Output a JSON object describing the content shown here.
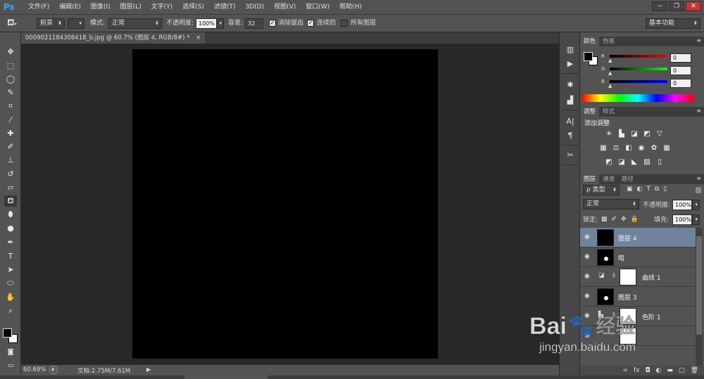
{
  "menubar": {
    "logo": "Ps",
    "items": [
      "文件(F)",
      "编辑(E)",
      "图像(I)",
      "图层(L)",
      "文字(Y)",
      "选择(S)",
      "滤镜(T)",
      "3D(D)",
      "视图(V)",
      "窗口(W)",
      "帮助(H)"
    ],
    "window_controls": [
      "−",
      "❐",
      "✕"
    ]
  },
  "options": {
    "fill_source": "前景",
    "mode_label": "模式:",
    "mode_value": "正常",
    "opacity_label": "不透明度:",
    "opacity_value": "100%",
    "tolerance_label": "容差:",
    "tolerance_value": "32",
    "antialias_label": "消除锯齿",
    "contiguous_label": "连续的",
    "all_layers_label": "所有图层",
    "workspace": "基本功能"
  },
  "document": {
    "tab_title": "0009021184308418_b.jpg @ 60.7% (图层 4, RGB/8#) *",
    "tab_close": "×"
  },
  "status": {
    "zoom": "60.69%",
    "doc_info": "文档:2.75M/7.61M"
  },
  "color_panel": {
    "tabs": [
      "颜色",
      "色板"
    ],
    "channels": [
      {
        "label": "R",
        "value": "0",
        "color": "#e03030"
      },
      {
        "label": "G",
        "value": "0",
        "color": "#20c020"
      },
      {
        "label": "B",
        "value": "0",
        "color": "#2040e0"
      }
    ]
  },
  "adjust_panel": {
    "tabs": [
      "调整",
      "样式"
    ],
    "title": "添加调整",
    "row1": [
      "☀",
      "▙",
      "◪",
      "◩",
      "▽"
    ],
    "row2": [
      "▦",
      "⚖",
      "◧",
      "◉",
      "✿",
      "▦"
    ],
    "row3": [
      "◩",
      "◪",
      "◣",
      "▨",
      "▯"
    ]
  },
  "layers_panel": {
    "tabs": [
      "图层",
      "通道",
      "路径"
    ],
    "filter_label": "ρ 类型",
    "blend_mode": "正常",
    "opacity_label": "不透明度:",
    "opacity_value": "100%",
    "lock_label": "锁定:",
    "fill_label": "填充:",
    "fill_value": "100%",
    "layers": [
      {
        "name": "图层 4",
        "selected": true,
        "thumb": "black"
      },
      {
        "name": "暗",
        "selected": false,
        "thumb": "mask"
      },
      {
        "name": "曲线 1",
        "selected": false,
        "thumb": "white",
        "adjustment": true
      },
      {
        "name": "图层 3",
        "selected": false,
        "thumb": "mask"
      },
      {
        "name": "色阶 1",
        "selected": false,
        "thumb": "white",
        "adjustment": true
      }
    ],
    "footer_icons": [
      "∞",
      "fx",
      "◘",
      "◐",
      "▬",
      "▢",
      "🗑"
    ]
  },
  "watermark": {
    "brand": "Bai",
    "brand_cn": "经验",
    "url": "jingyan.baidu.com"
  }
}
